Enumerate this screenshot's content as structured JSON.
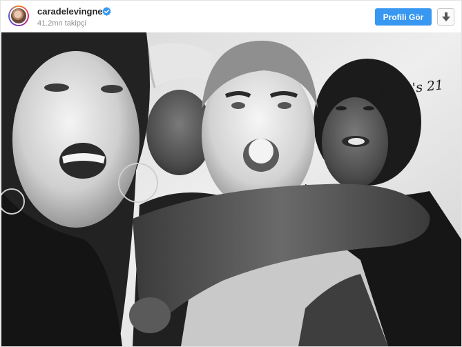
{
  "post": {
    "username": "caradelevingne",
    "followers": "41.2mn takipçi",
    "profile_button": "Profili Gör",
    "verified_icon": "verified-badge-icon",
    "download_icon": "download-arrow-icon"
  },
  "photo": {
    "watermark": "Kylie's 21",
    "style": "black-and-white"
  },
  "colors": {
    "accent": "#3897f0",
    "verified": "#3897f0",
    "text_primary": "#262626",
    "text_secondary": "#8e8e8e"
  }
}
